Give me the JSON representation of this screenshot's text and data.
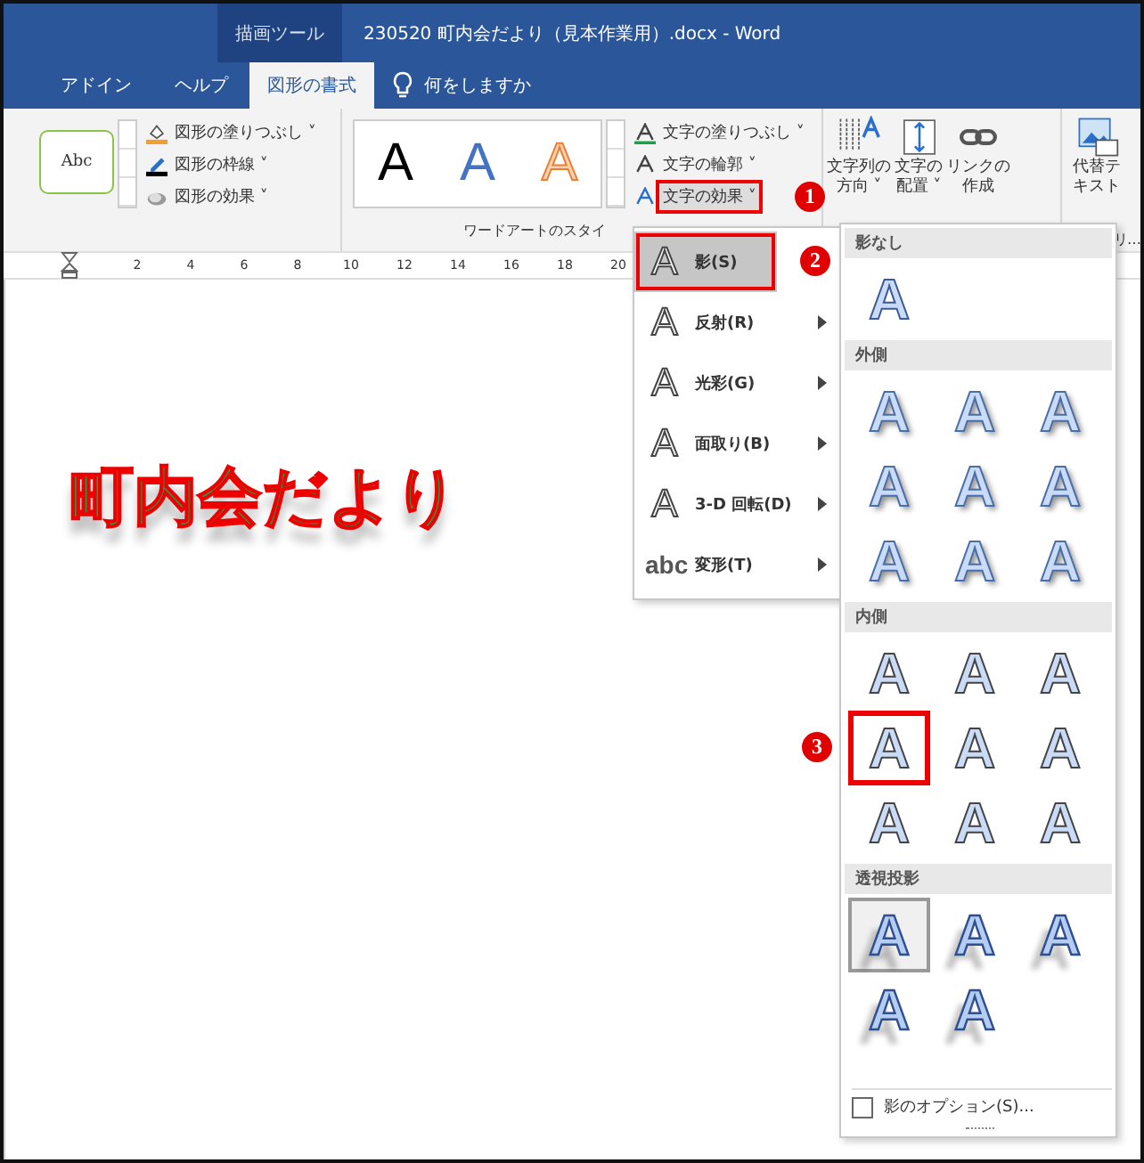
{
  "title_bar": {
    "context_tab": "描画ツール",
    "title": "230520 町内会だより（見本作業用）.docx  -  Word"
  },
  "tabs": [
    {
      "label": "アドイン",
      "selected": false
    },
    {
      "label": "ヘルプ",
      "selected": false
    },
    {
      "label": "図形の書式",
      "selected": true
    }
  ],
  "tell_me": {
    "placeholder": "何をしますか"
  },
  "ribbon": {
    "shape_styles": {
      "preview": "Abc",
      "commands": [
        {
          "label": "図形の塗りつぶし ˅",
          "kind": "fill"
        },
        {
          "label": "図形の枠線 ˅",
          "kind": "outline"
        },
        {
          "label": "図形の効果 ˅",
          "kind": "effect"
        }
      ]
    },
    "wordart": {
      "styles": [
        {
          "glyph": "A",
          "kind": "black"
        },
        {
          "glyph": "A",
          "kind": "blue"
        },
        {
          "glyph": "A",
          "kind": "orange"
        }
      ],
      "commands": [
        {
          "label": "文字の塗りつぶし ˅",
          "kind": "fill"
        },
        {
          "label": "文字の輪郭 ˅",
          "kind": "outline"
        },
        {
          "label": "文字の効果 ˅",
          "kind": "effect",
          "callout": "1"
        }
      ],
      "group_label": "ワードアートのスタイ"
    },
    "text_group": [
      {
        "lines": [
          "文字列の",
          "方向 ˅"
        ],
        "kind": "direction"
      },
      {
        "lines": [
          "文字の",
          "配置 ˅"
        ],
        "kind": "align"
      },
      {
        "lines": [
          "リンクの",
          "作成"
        ],
        "kind": "link"
      }
    ],
    "alt_text": {
      "lines": [
        "代替テ",
        "キスト"
      ]
    },
    "cut_label": "リ…"
  },
  "ruler": {
    "ticks": [
      "2",
      "4",
      "6",
      "8",
      "10",
      "12",
      "14",
      "16",
      "18",
      "20"
    ]
  },
  "document": {
    "wordart_text": "町内会だより"
  },
  "effects_menu": [
    {
      "icon": "A",
      "label": "影(S)",
      "selected": true,
      "callout": "2"
    },
    {
      "icon": "A",
      "label": "反射(R)",
      "selected": false
    },
    {
      "icon": "A",
      "label": "光彩(G)",
      "selected": false
    },
    {
      "icon": "A",
      "label": "面取り(B)",
      "selected": false
    },
    {
      "icon": "A",
      "label": "3-D 回転(D)",
      "selected": false
    },
    {
      "icon": "abc",
      "label": "変形(T)",
      "selected": false
    }
  ],
  "shadow_gallery": {
    "sections": [
      {
        "header": "影なし",
        "kind": "none",
        "items": [
          {
            "glyph": "A",
            "selected": false
          }
        ]
      },
      {
        "header": "外側",
        "kind": "outer",
        "items": [
          {
            "glyph": "A",
            "selected": false
          },
          {
            "glyph": "A",
            "selected": false
          },
          {
            "glyph": "A",
            "selected": false
          },
          {
            "glyph": "A",
            "selected": false
          },
          {
            "glyph": "A",
            "selected": false
          },
          {
            "glyph": "A",
            "selected": false
          },
          {
            "glyph": "A",
            "selected": false
          },
          {
            "glyph": "A",
            "selected": false
          },
          {
            "glyph": "A",
            "selected": false
          }
        ]
      },
      {
        "header": "内側",
        "kind": "inner",
        "items": [
          {
            "glyph": "A",
            "selected": false
          },
          {
            "glyph": "A",
            "selected": false
          },
          {
            "glyph": "A",
            "selected": false
          },
          {
            "glyph": "A",
            "selected": false,
            "callout": "3"
          },
          {
            "glyph": "A",
            "selected": false
          },
          {
            "glyph": "A",
            "selected": false
          },
          {
            "glyph": "A",
            "selected": false
          },
          {
            "glyph": "A",
            "selected": false
          },
          {
            "glyph": "A",
            "selected": false
          }
        ]
      },
      {
        "header": "透視投影",
        "kind": "perspective",
        "items": [
          {
            "glyph": "A",
            "selected": true
          },
          {
            "glyph": "A",
            "selected": false
          },
          {
            "glyph": "A",
            "selected": false
          },
          {
            "glyph": "A",
            "selected": false
          },
          {
            "glyph": "A",
            "selected": false
          }
        ]
      }
    ],
    "options": {
      "label": "影のオプション(S)...",
      "checked": false
    }
  }
}
